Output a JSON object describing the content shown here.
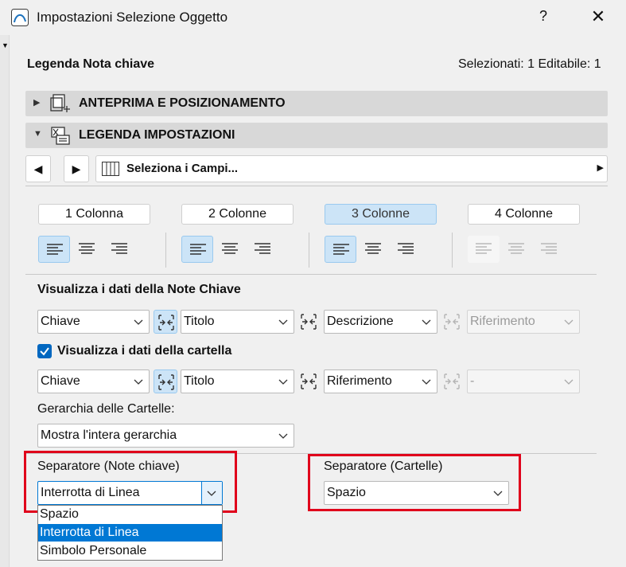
{
  "window": {
    "title": "Impostazioni Selezione Oggetto",
    "help_label": "?",
    "close_label": "✕"
  },
  "header": {
    "title": "Legenda Nota chiave",
    "selection_info": "Selezionati: 1 Editabile: 1"
  },
  "sections": {
    "preview": {
      "label": "ANTEPRIMA E POSIZIONAMENTO",
      "expanded": false,
      "icon": "preview-placement-icon"
    },
    "legend": {
      "label": "LEGENDA IMPOSTAZIONI",
      "expanded": true,
      "icon": "legend-settings-icon"
    }
  },
  "field_selector": {
    "label": "Seleziona i Campi...",
    "prev": "◀",
    "next": "▶"
  },
  "columns": {
    "tabs": [
      {
        "label": "1 Colonna",
        "active": false
      },
      {
        "label": "2 Colonne",
        "active": false
      },
      {
        "label": "3 Colonne",
        "active": true
      },
      {
        "label": "4 Colonne",
        "active": false
      }
    ],
    "alignment_selected": "left"
  },
  "keynote_data": {
    "title": "Visualizza i dati della Note Chiave",
    "fields": [
      "Chiave",
      "Titolo",
      "Descrizione",
      "Riferimento"
    ]
  },
  "folder_data": {
    "checkbox_label": "Visualizza i dati della cartella",
    "checked": true,
    "fields": [
      "Chiave",
      "Titolo",
      "Riferimento",
      "-"
    ]
  },
  "hierarchy": {
    "label": "Gerarchia delle Cartelle:",
    "value": "Mostra l'intera gerarchia"
  },
  "separator_keynote": {
    "label": "Separatore (Note chiave)",
    "value": "Interrotta di Linea",
    "options": [
      "Spazio",
      "Interrotta di Linea",
      "Simbolo Personale"
    ],
    "highlighted": "Interrotta di Linea"
  },
  "separator_folders": {
    "label": "Separatore (Cartelle)",
    "value": "Spazio"
  },
  "colors": {
    "accent": "#0078d4",
    "selected_bg": "#cce4f7",
    "highlight_box": "#e0001b",
    "section_bg": "#d8d8d8"
  }
}
